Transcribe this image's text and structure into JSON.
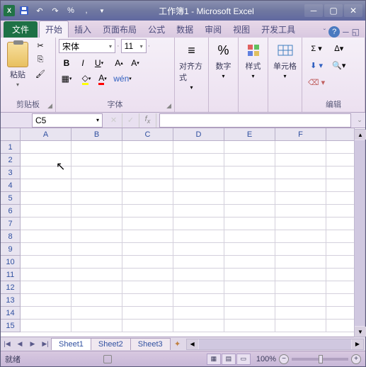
{
  "title": "工作簿1 - Microsoft Excel",
  "qat": {
    "percent": "%",
    "comma": ","
  },
  "tabs": [
    "文件",
    "开始",
    "插入",
    "页面布局",
    "公式",
    "数据",
    "审阅",
    "视图",
    "开发工具"
  ],
  "ribbon": {
    "clipboard": {
      "paste": "粘贴",
      "label": "剪贴板"
    },
    "font": {
      "name": "宋体",
      "size": "11",
      "label": "字体"
    },
    "align": {
      "label": "对齐方式"
    },
    "number": {
      "label": "数字"
    },
    "styles": {
      "label": "样式"
    },
    "cells": {
      "label": "单元格"
    },
    "editing": {
      "label": "编辑"
    }
  },
  "formula_bar": {
    "cell_ref": "C5"
  },
  "grid": {
    "columns": [
      "A",
      "B",
      "C",
      "D",
      "E",
      "F"
    ],
    "row_count": 15
  },
  "sheets": [
    "Sheet1",
    "Sheet2",
    "Sheet3"
  ],
  "status": {
    "ready": "就绪",
    "zoom": "100%"
  }
}
